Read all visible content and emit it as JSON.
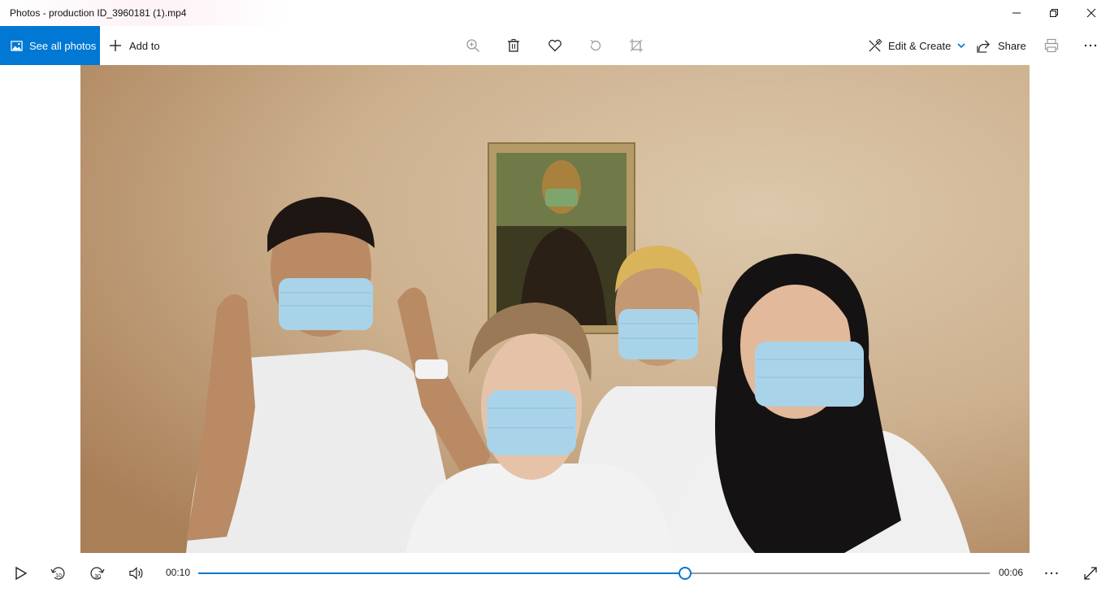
{
  "window": {
    "title": "Photos - production ID_3960181 (1).mp4",
    "controls": [
      "minimize-icon",
      "restore-icon",
      "close-icon"
    ]
  },
  "toolbar": {
    "see_all_label": "See all photos",
    "add_to_label": "Add to",
    "center_icons": [
      "zoom-in-icon",
      "delete-icon",
      "favorite-heart-icon",
      "rotate-icon",
      "crop-icon"
    ],
    "edit_create_label": "Edit & Create",
    "share_label": "Share",
    "right_icons": [
      "print-icon",
      "more-options-icon"
    ]
  },
  "player": {
    "elapsed": "00:10",
    "remaining": "00:06",
    "progress": 0.615,
    "skip_back_label": "10",
    "skip_forward_label": "30",
    "icons": [
      "play-icon",
      "skip-back-10-icon",
      "skip-forward-30-icon",
      "volume-icon",
      "more-options-icon",
      "fullscreen-icon"
    ]
  },
  "colors": {
    "accent": "#0078d4",
    "background": "#ffffff",
    "wall": "#cdb392",
    "track": "#9a9a9a"
  }
}
